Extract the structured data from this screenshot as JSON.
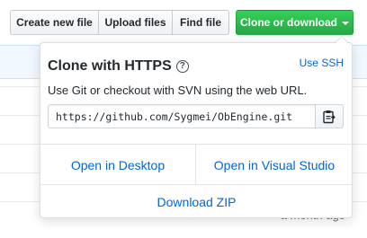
{
  "toolbar": {
    "create_new_file": "Create new file",
    "upload_files": "Upload files",
    "find_file": "Find file",
    "clone_or_download": "Clone or download"
  },
  "clone_panel": {
    "title": "Clone with HTTPS",
    "help_glyph": "?",
    "use_ssh": "Use SSH",
    "description": "Use Git or checkout with SVN using the web URL.",
    "url": "https://github.com/Sygmei/ObEngine.git",
    "open_desktop": "Open in Desktop",
    "open_visual_studio": "Open in Visual Studio",
    "download_zip": "Download ZIP"
  },
  "background": {
    "commit_age": "a month ago"
  },
  "icons": {
    "help": "question-circle-icon",
    "copy": "clipboard-icon",
    "caret": "caret-down-icon"
  },
  "colors": {
    "primary_button": "#28a745",
    "link": "#0366d6"
  }
}
